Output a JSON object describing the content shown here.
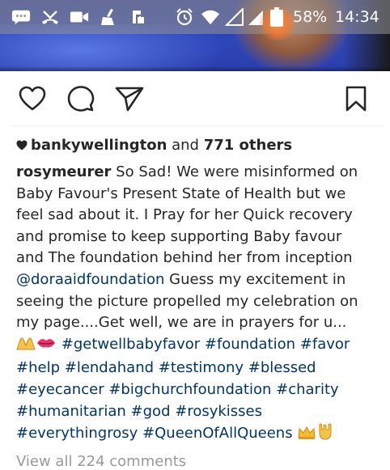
{
  "status_bar": {
    "battery_percent": "58%",
    "time": "14:34"
  },
  "post": {
    "likes": {
      "first_liker": "bankywellington",
      "joiner": " and ",
      "others": "771 others"
    },
    "caption": {
      "username": "rosymeurer",
      "text_before_mention": "So Sad! We were misinformed on Baby Favour's Present State of Health but we feel sad about it. I Pray for her Quick recovery and promise to keep supporting Baby favour and The foundation behind her from inception",
      "mention": "@doraaidfoundation",
      "text_after_mention": "Guess my excitement in seeing the picture propelled my celebration on my page....Get well, we are in prayers for u...",
      "hashtags": [
        "#getwellbabyfavor",
        "#foundation",
        "#favor",
        "#help",
        "#lendahand",
        "#testimony",
        "#blessed",
        "#eyecancer",
        "#bigchurchfoundation",
        "#charity",
        "#humanitarian",
        "#god",
        "#rosykisses",
        "#everythingrosy",
        "#QueenOfAllQueens"
      ]
    },
    "view_comments": "View all 224 comments"
  },
  "colors": {
    "link": "#003569",
    "text": "#262626",
    "muted": "#999999"
  }
}
